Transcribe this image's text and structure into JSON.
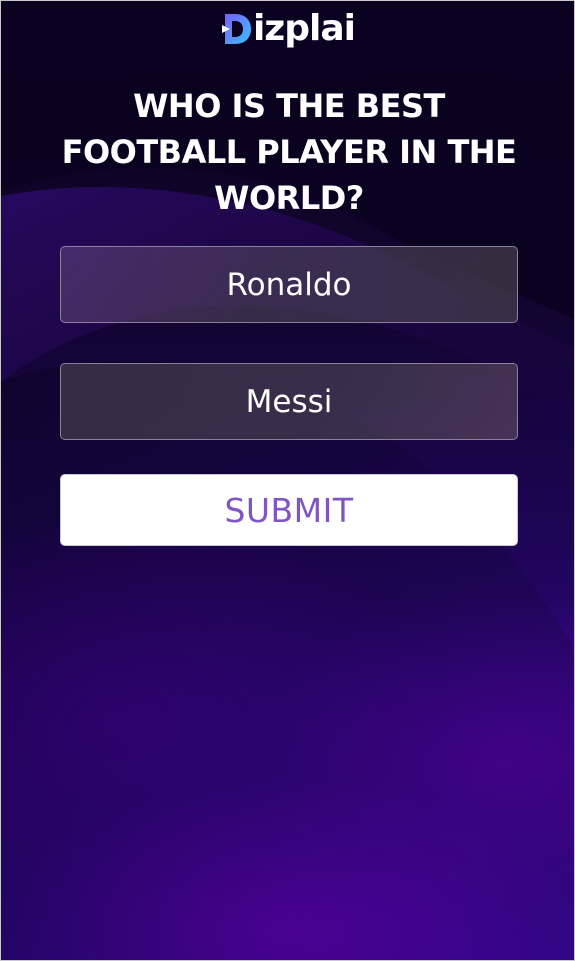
{
  "brand": {
    "name": "Dizplai",
    "text": "izplai",
    "logo_icon": "dizplai-d-logo-icon",
    "logo_gradient": [
      "#7b5cff",
      "#39c3ff"
    ]
  },
  "poll": {
    "question": "WHO IS THE BEST FOOTBALL PLAYER IN THE WORLD?",
    "options": [
      {
        "label": "Ronaldo"
      },
      {
        "label": "Messi"
      }
    ],
    "submit_label": "SUBMIT"
  },
  "colors": {
    "background_top": "#0c0220",
    "background_bottom": "#3a06a0",
    "submit_text": "#8056c3",
    "submit_background": "#ffffff"
  }
}
